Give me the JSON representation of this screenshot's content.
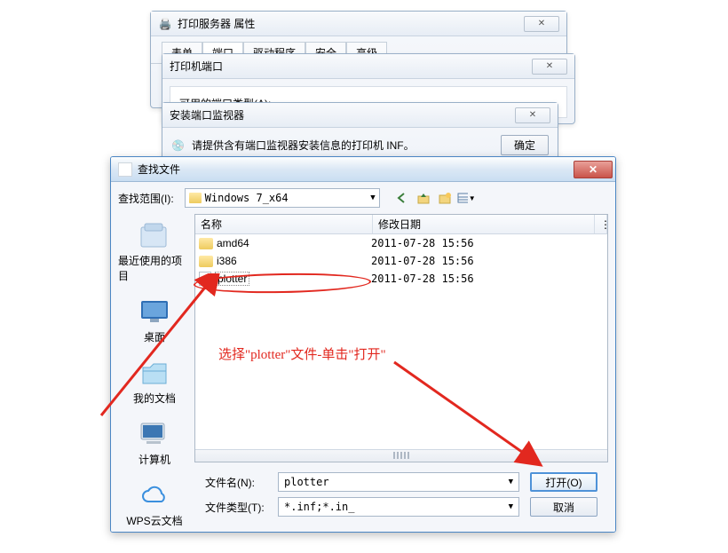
{
  "bg1": {
    "title": "打印服务器 属性",
    "tabs": [
      "表单",
      "端口",
      "驱动程序",
      "安全",
      "高级"
    ],
    "active_tab": 1
  },
  "bg2": {
    "title": "打印机端口",
    "label": "可用的端口类型(A):"
  },
  "bg3": {
    "title": "安装端口监视器",
    "text": "请提供含有端口监视器安装信息的打印机 INF。",
    "ok": "确定"
  },
  "file_dialog": {
    "title": "查找文件",
    "scope_label": "查找范围(I):",
    "folder": "Windows 7_x64",
    "columns": {
      "name": "名称",
      "date": "修改日期"
    },
    "rows": [
      {
        "type": "folder",
        "name": "amd64",
        "date": "2011-07-28 15:56",
        "sel": false
      },
      {
        "type": "folder",
        "name": "i386",
        "date": "2011-07-28 15:56",
        "sel": false
      },
      {
        "type": "file",
        "name": "plotter",
        "date": "2011-07-28 15:56",
        "sel": true
      }
    ],
    "filename_label": "文件名(N):",
    "filename_value": "plotter",
    "filetype_label": "文件类型(T):",
    "filetype_value": "*.inf;*.in_",
    "open_btn": "打开(O)",
    "cancel_btn": "取消",
    "sidebar": [
      {
        "label": "最近使用的项目"
      },
      {
        "label": "桌面"
      },
      {
        "label": "我的文档"
      },
      {
        "label": "计算机"
      },
      {
        "label": "WPS云文档"
      }
    ],
    "tb_icons": [
      "back",
      "up",
      "new-folder",
      "views"
    ]
  },
  "annotation": {
    "text": "选择\"plotter\"文件-单击\"打开\""
  }
}
